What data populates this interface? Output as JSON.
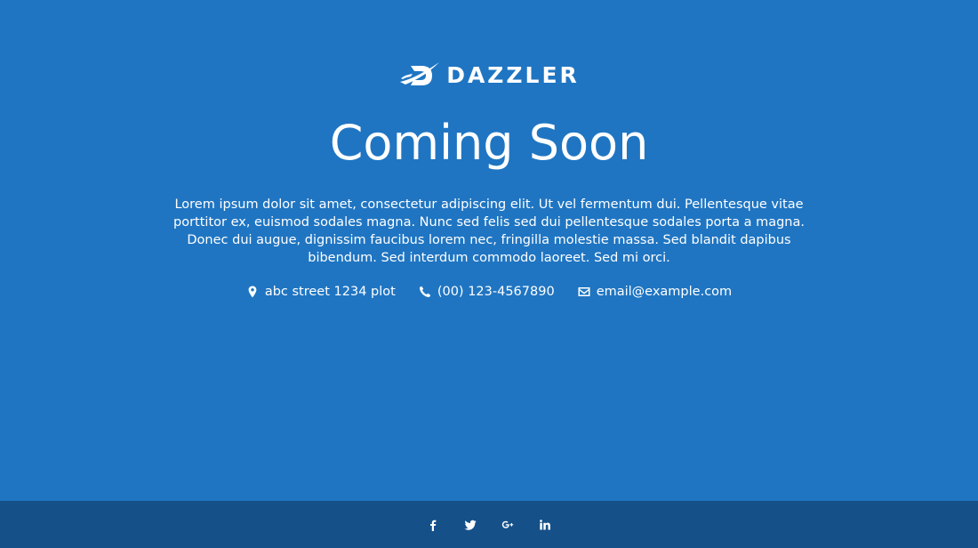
{
  "brand": {
    "name": "DAZZLER",
    "logo_icon": "dazzler-logo-icon"
  },
  "hero": {
    "title": "Coming Soon",
    "description": "Lorem ipsum dolor sit amet, consectetur adipiscing elit. Ut vel fermentum dui. Pellentesque vitae porttitor ex, euismod sodales magna. Nunc sed felis sed dui pellentesque sodales porta a magna. Donec dui augue, dignissim faucibus lorem nec, fringilla molestie massa. Sed blandit dapibus bibendum. Sed interdum commodo laoreet. Sed mi orci."
  },
  "contacts": [
    {
      "icon": "map-marker-icon",
      "text": "abc street 1234 plot"
    },
    {
      "icon": "phone-icon",
      "text": "(00) 123-4567890"
    },
    {
      "icon": "envelope-icon",
      "text": "email@example.com"
    }
  ],
  "social": [
    {
      "icon": "facebook-icon"
    },
    {
      "icon": "twitter-icon"
    },
    {
      "icon": "google-plus-icon"
    },
    {
      "icon": "linkedin-icon"
    }
  ],
  "colors": {
    "background": "#1f75c2",
    "footer": "#155089",
    "text": "#ffffff"
  }
}
